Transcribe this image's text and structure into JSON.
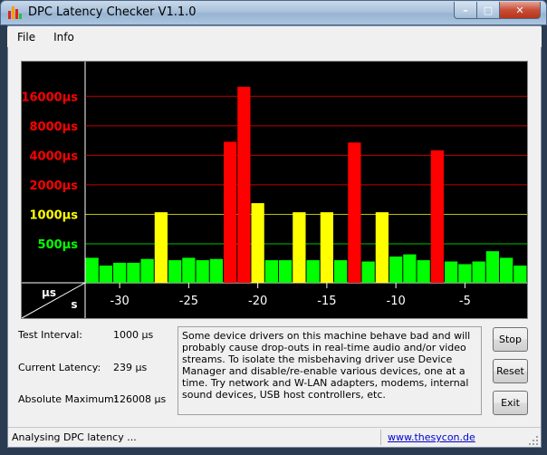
{
  "window": {
    "title": "DPC Latency Checker V1.1.0"
  },
  "window_controls": {
    "minimize": "–",
    "maximize": "□",
    "close": "✕"
  },
  "menu": {
    "items": [
      "File",
      "Info"
    ]
  },
  "chart_data": {
    "type": "bar",
    "y_tick_labels": [
      "16000µs",
      "8000µs",
      "4000µs",
      "2000µs",
      "1000µs",
      "500µs"
    ],
    "y_tick_colors": [
      "#ff0000",
      "#ff0000",
      "#ff0000",
      "#ff0000",
      "#ffff00",
      "#00ff00"
    ],
    "y_tick_values": [
      16000,
      8000,
      4000,
      2000,
      1000,
      500
    ],
    "y_scale": "log",
    "ylim": [
      200,
      28000
    ],
    "x_tick_labels": [
      "-30",
      "-25",
      "-20",
      "-15",
      "-10",
      "-5"
    ],
    "x_tick_values": [
      -30,
      -25,
      -20,
      -15,
      -10,
      -5
    ],
    "x_range": [
      -32,
      0
    ],
    "unit_y": "µs",
    "unit_x": "s",
    "thresholds": {
      "red_above": 2000,
      "yellow_above": 500
    },
    "colors": {
      "green": "#00ff00",
      "yellow": "#ffff00",
      "red": "#ff0000",
      "background": "#000000"
    },
    "x": [
      -32,
      -31,
      -30,
      -29,
      -28,
      -27,
      -26,
      -25,
      -24,
      -23,
      -22,
      -21,
      -20,
      -19,
      -18,
      -17,
      -16,
      -15,
      -14,
      -13,
      -12,
      -11,
      -10,
      -9,
      -8,
      -7,
      -6,
      -5,
      -4,
      -3,
      -2,
      -1
    ],
    "values": [
      360,
      300,
      320,
      320,
      350,
      1050,
      340,
      360,
      340,
      350,
      5500,
      20000,
      1300,
      340,
      340,
      1050,
      340,
      1050,
      340,
      5400,
      330,
      1050,
      370,
      390,
      340,
      4500,
      330,
      310,
      330,
      420,
      360,
      300
    ]
  },
  "info": {
    "test_interval_label": "Test Interval:",
    "test_interval_value": "1000 µs",
    "current_latency_label": "Current Latency:",
    "current_latency_value": "239 µs",
    "absolute_max_label": "Absolute Maximum:",
    "absolute_max_value": "126008 µs"
  },
  "message": "Some device drivers on this machine behave bad and will probably cause drop-outs in real-time audio and/or video streams. To isolate the misbehaving driver use Device Manager and disable/re-enable various devices, one at a time. Try network and W-LAN adapters, modems, internal sound devices, USB host controllers, etc.",
  "buttons": {
    "stop": "Stop",
    "reset": "Reset",
    "exit": "Exit"
  },
  "status": {
    "text": "Analysing DPC latency ...",
    "link": "www.thesycon.de"
  }
}
